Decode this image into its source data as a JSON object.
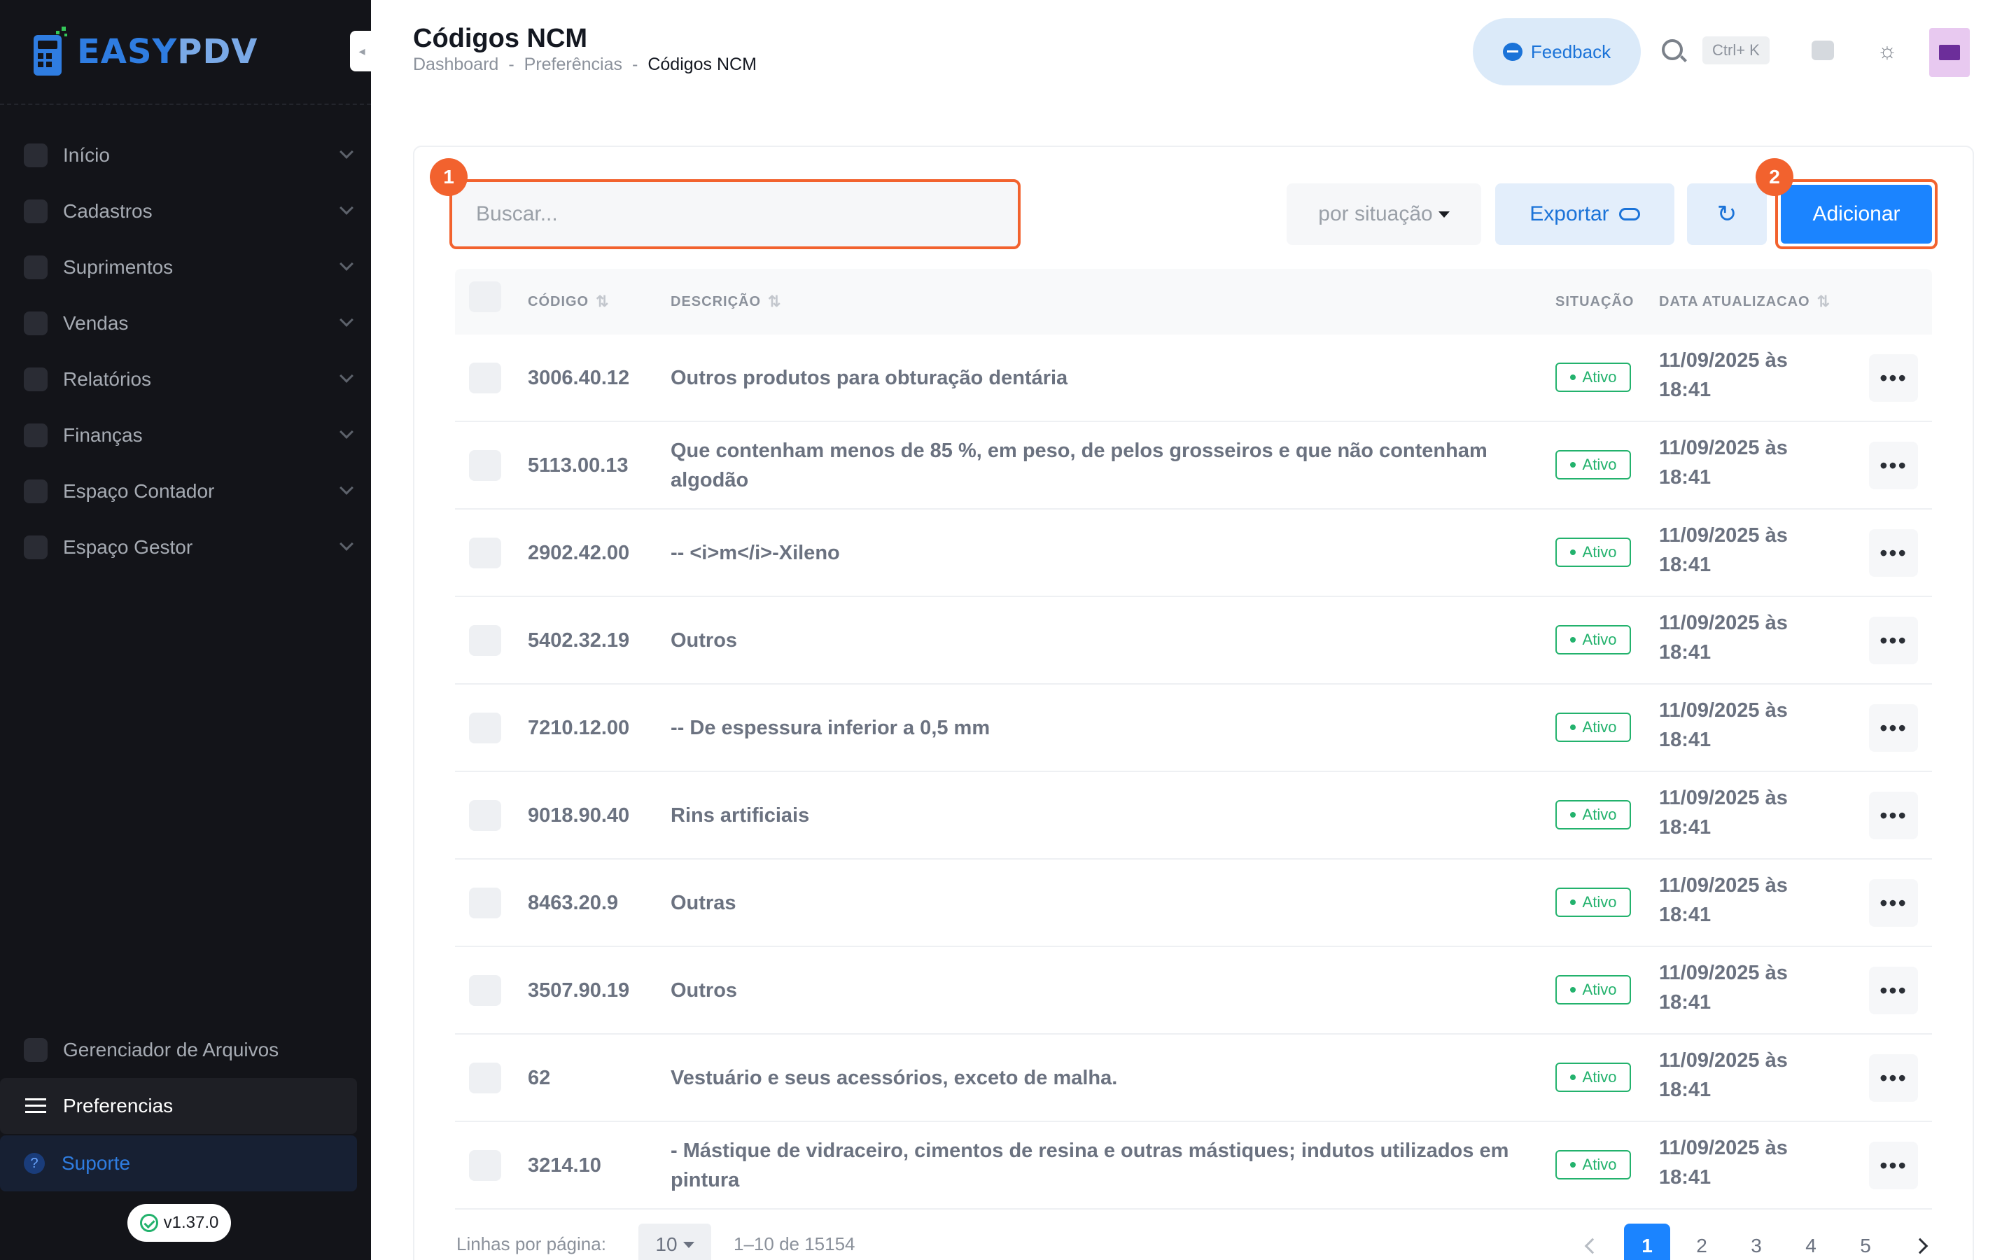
{
  "app": {
    "logo_easy": "EASY",
    "logo_pdv": "PDV",
    "version": "v1.37.0"
  },
  "sidebar": {
    "items": [
      {
        "label": "Início",
        "icon": "grid-icon"
      },
      {
        "label": "Cadastros",
        "icon": "id-card-icon"
      },
      {
        "label": "Suprimentos",
        "icon": "box-icon"
      },
      {
        "label": "Vendas",
        "icon": "register-icon"
      },
      {
        "label": "Relatórios",
        "icon": "chart-icon"
      },
      {
        "label": "Finanças",
        "icon": "dollar-icon"
      },
      {
        "label": "Espaço Contador",
        "icon": "calculator-icon"
      },
      {
        "label": "Espaço Gestor",
        "icon": "users-icon"
      }
    ],
    "bottom": {
      "files": "Gerenciador de Arquivos",
      "preferences": "Preferencias",
      "support": "Suporte",
      "support_glyph": "?"
    }
  },
  "header": {
    "title": "Códigos NCM",
    "breadcrumb": [
      "Dashboard",
      "Preferências",
      "Códigos NCM"
    ],
    "breadcrumb_sep": "-",
    "feedback_label": "Feedback",
    "search_shortcut": "Ctrl+ K"
  },
  "toolbar": {
    "search_placeholder": "Buscar...",
    "badge_search": "1",
    "badge_add": "2",
    "filter_label": "por situação",
    "export_label": "Exportar",
    "refresh_glyph": "↻",
    "add_label": "Adicionar"
  },
  "table": {
    "columns": {
      "code": "CÓDIGO",
      "description": "DESCRIÇÃO",
      "status": "SITUAÇÃO",
      "updated": "DATA ATUALIZACAO"
    },
    "rows": [
      {
        "code": "3006.40.12",
        "description": "Outros produtos para obturação dentária",
        "status": "Ativo",
        "date": "11/09/2025 às",
        "time": "18:41"
      },
      {
        "code": "5113.00.13",
        "description": "Que contenham menos de 85 %, em peso, de pelos grosseiros e que não contenham algodão",
        "status": "Ativo",
        "date": "11/09/2025 às",
        "time": "18:41"
      },
      {
        "code": "2902.42.00",
        "description": "-- <i>m</i>-Xileno",
        "status": "Ativo",
        "date": "11/09/2025 às",
        "time": "18:41"
      },
      {
        "code": "5402.32.19",
        "description": "Outros",
        "status": "Ativo",
        "date": "11/09/2025 às",
        "time": "18:41"
      },
      {
        "code": "7210.12.00",
        "description": "-- De espessura inferior a 0,5 mm",
        "status": "Ativo",
        "date": "11/09/2025 às",
        "time": "18:41"
      },
      {
        "code": "9018.90.40",
        "description": "Rins artificiais",
        "status": "Ativo",
        "date": "11/09/2025 às",
        "time": "18:41"
      },
      {
        "code": "8463.20.9",
        "description": "Outras",
        "status": "Ativo",
        "date": "11/09/2025 às",
        "time": "18:41"
      },
      {
        "code": "3507.90.19",
        "description": "Outros",
        "status": "Ativo",
        "date": "11/09/2025 às",
        "time": "18:41"
      },
      {
        "code": "62",
        "description": "Vestuário e seus acessórios, exceto de malha.",
        "status": "Ativo",
        "date": "11/09/2025 às",
        "time": "18:41"
      },
      {
        "code": "3214.10",
        "description": "- Mástique de vidraceiro, cimentos de resina e outras mástiques; indutos utilizados em pintura",
        "status": "Ativo",
        "date": "11/09/2025 às",
        "time": "18:41"
      }
    ],
    "more_glyph": "•••"
  },
  "footer": {
    "rows_label": "Linhas por página:",
    "rows_value": "10",
    "range": "1–10 de 15154",
    "pages": [
      "1",
      "2",
      "3",
      "4",
      "5"
    ],
    "active_page": "1"
  },
  "colors": {
    "brand": "#1b84ff",
    "highlight": "#f2622e",
    "success": "#23b26d",
    "sidebar_bg": "#131419"
  }
}
